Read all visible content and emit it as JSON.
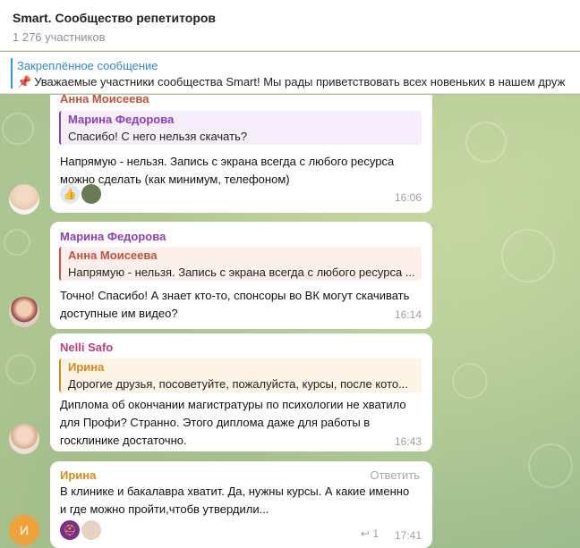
{
  "header": {
    "title": "Smart. Сообщество репетиторов",
    "members": "1 276 участников"
  },
  "pinned": {
    "label": "Закреплённое сообщение",
    "icon": "pushpin-icon",
    "text": "Уважаемые участники сообщества Smart!  Мы рады приветствовать всех новеньких в нашем друж"
  },
  "messages": [
    {
      "author": "Анна Моисеева",
      "author_color": "#c9503a",
      "reply_name": "Марина Федорова",
      "reply_color": "#8e3fb5",
      "reply_text": "Спасибо! С него нельзя скачать?",
      "text": "Напрямую - нельзя. Запись с экрана всегда с любого ресурса можно сделать (как минимум, телефоном)",
      "time": "16:06",
      "reactions": [
        "thumbs-up-icon",
        "user-avatar-icon"
      ]
    },
    {
      "author": "Марина Федорова",
      "author_color": "#8e3fb5",
      "reply_name": "Анна Моисеева",
      "reply_color": "#c9503a",
      "reply_text": "Напрямую - нельзя. Запись с экрана всегда с любого ресурса ...",
      "text": "Точно! Спасибо! А знает кто-то, спонсоры во ВК могут скачивать доступные им видео?",
      "time": "16:14"
    },
    {
      "author": "Nelli Safo",
      "author_color": "#c23d7a",
      "reply_name": "Ирина",
      "reply_color": "#d98a1e",
      "reply_text": "Дорогие друзья, посоветуйте, пожалуйста, курсы, после кото...",
      "text": "Диплома об окончании магистратуры по психологии не хватило для Профи? Странно. Этого диплома даже для работы в госклинике достаточно.",
      "time": "16:43"
    },
    {
      "author": "Ирина",
      "author_color": "#d98a1e",
      "reply_label": "Ответить",
      "text": "В клинике и бакалавра хватит. Да, нужны курсы. А какие именно и где можно пройти,чтобв утвердили...",
      "time": "17:41",
      "replies_count": "1",
      "avatar_letter": "И"
    }
  ]
}
